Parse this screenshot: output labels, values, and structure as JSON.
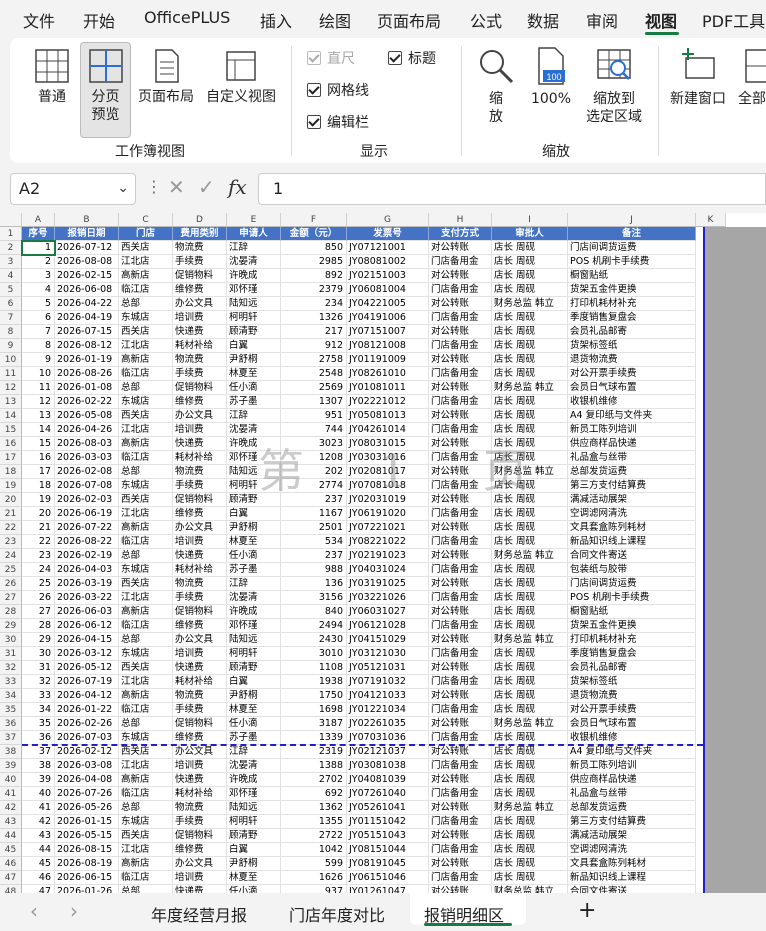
{
  "menu": {
    "items": [
      "文件",
      "开始",
      "OfficePLUS",
      "插入",
      "绘图",
      "页面布局",
      "公式",
      "数据",
      "审阅",
      "视图",
      "PDF工具"
    ],
    "active_index": 9
  },
  "ribbon": {
    "workbook_views": {
      "buttons": [
        "普通",
        "分页\n预览",
        "页面布局",
        "自定义视图"
      ],
      "selected": "分页\n预览",
      "group_label": "工作簿视图"
    },
    "show": {
      "checkboxes": [
        {
          "label": "直尺",
          "checked": true,
          "disabled": true
        },
        {
          "label": "标题",
          "checked": true,
          "disabled": false
        },
        {
          "label": "网格线",
          "checked": true,
          "disabled": false
        },
        {
          "label": "编辑栏",
          "checked": true,
          "disabled": false
        }
      ],
      "group_label": "显示"
    },
    "zoom": {
      "zoom_label": "缩\n放",
      "pct_label": "100%",
      "pct_icon_text": "100",
      "fit_label": "缩放到\n选定区域",
      "group_label": "缩放"
    },
    "window": {
      "new_window_label": "新建窗口",
      "all_label": "全部"
    }
  },
  "formula_bar": {
    "name_box": "A2",
    "chevron": "⌄",
    "cancel": "✕",
    "enter": "✓",
    "fx": "fx",
    "value": "1"
  },
  "sheet": {
    "col_letters": [
      "A",
      "B",
      "C",
      "D",
      "E",
      "F",
      "G",
      "H",
      "I",
      "J",
      "K"
    ],
    "headers": [
      "序号",
      "报销日期",
      "门店",
      "费用类别",
      "申请人",
      "金额（元）",
      "发票号",
      "支付方式",
      "审批人",
      "备注"
    ],
    "watermark": "第 1 页",
    "rows": [
      [
        "1",
        "2026-07-12",
        "西关店",
        "物流费",
        "江辞",
        "850",
        "JY07121001",
        "对公转账",
        "店长 周砚",
        "门店间调货运费"
      ],
      [
        "2",
        "2026-08-08",
        "江北店",
        "手续费",
        "沈晏清",
        "2985",
        "JY08081002",
        "门店备用金",
        "店长 周砚",
        "POS 机刷卡手续费"
      ],
      [
        "3",
        "2026-02-15",
        "高新店",
        "促销物料",
        "许晚成",
        "892",
        "JY02151003",
        "对公转账",
        "店长 周砚",
        "橱窗贴纸"
      ],
      [
        "4",
        "2026-06-08",
        "临江店",
        "维修费",
        "邓怀瑾",
        "2379",
        "JY06081004",
        "门店备用金",
        "店长 周砚",
        "货架五金件更换"
      ],
      [
        "5",
        "2026-04-22",
        "总部",
        "办公文具",
        "陆知远",
        "234",
        "JY04221005",
        "对公转账",
        "财务总监 韩立",
        "打印机耗材补充"
      ],
      [
        "6",
        "2026-04-19",
        "东城店",
        "培训费",
        "柯明轩",
        "1326",
        "JY04191006",
        "门店备用金",
        "店长 周砚",
        "季度销售复盘会"
      ],
      [
        "7",
        "2026-07-15",
        "西关店",
        "快递费",
        "顾清野",
        "217",
        "JY07151007",
        "对公转账",
        "店长 周砚",
        "会员礼品邮寄"
      ],
      [
        "8",
        "2026-08-12",
        "江北店",
        "耗材补给",
        "白翼",
        "912",
        "JY08121008",
        "门店备用金",
        "店长 周砚",
        "货架标签纸"
      ],
      [
        "9",
        "2026-01-19",
        "高新店",
        "物流费",
        "尹舒桐",
        "2758",
        "JY01191009",
        "对公转账",
        "店长 周砚",
        "退货物流费"
      ],
      [
        "10",
        "2026-08-26",
        "临江店",
        "手续费",
        "林夏至",
        "2548",
        "JY08261010",
        "门店备用金",
        "店长 周砚",
        "对公开票手续费"
      ],
      [
        "11",
        "2026-01-08",
        "总部",
        "促销物料",
        "任小滴",
        "2569",
        "JY01081011",
        "对公转账",
        "财务总监 韩立",
        "会员日气球布置"
      ],
      [
        "12",
        "2026-02-22",
        "东城店",
        "维修费",
        "苏子墨",
        "1307",
        "JY02221012",
        "门店备用金",
        "店长 周砚",
        "收银机维修"
      ],
      [
        "13",
        "2026-05-08",
        "西关店",
        "办公文具",
        "江辞",
        "951",
        "JY05081013",
        "对公转账",
        "店长 周砚",
        "A4 复印纸与文件夹"
      ],
      [
        "14",
        "2026-04-26",
        "江北店",
        "培训费",
        "沈晏清",
        "744",
        "JY04261014",
        "门店备用金",
        "店长 周砚",
        "新员工陈列培训"
      ],
      [
        "15",
        "2026-08-03",
        "高新店",
        "快递费",
        "许晚成",
        "3023",
        "JY08031015",
        "对公转账",
        "店长 周砚",
        "供应商样品快递"
      ],
      [
        "16",
        "2026-03-03",
        "临江店",
        "耗材补给",
        "邓怀瑾",
        "1208",
        "JY03031016",
        "门店备用金",
        "店长 周砚",
        "礼品盒与丝带"
      ],
      [
        "17",
        "2026-02-08",
        "总部",
        "物流费",
        "陆知远",
        "202",
        "JY02081017",
        "对公转账",
        "财务总监 韩立",
        "总部发货运费"
      ],
      [
        "18",
        "2026-07-08",
        "东城店",
        "手续费",
        "柯明轩",
        "2774",
        "JY07081018",
        "门店备用金",
        "店长 周砚",
        "第三方支付结算费"
      ],
      [
        "19",
        "2026-02-03",
        "西关店",
        "促销物料",
        "顾清野",
        "237",
        "JY02031019",
        "对公转账",
        "店长 周砚",
        "满减活动展架"
      ],
      [
        "20",
        "2026-06-19",
        "江北店",
        "维修费",
        "白翼",
        "1167",
        "JY06191020",
        "门店备用金",
        "店长 周砚",
        "空调滤网清洗"
      ],
      [
        "21",
        "2026-07-22",
        "高新店",
        "办公文具",
        "尹舒桐",
        "2501",
        "JY07221021",
        "对公转账",
        "店长 周砚",
        "文具套盒陈列耗材"
      ],
      [
        "22",
        "2026-08-22",
        "临江店",
        "培训费",
        "林夏至",
        "534",
        "JY08221022",
        "门店备用金",
        "店长 周砚",
        "新品知识线上课程"
      ],
      [
        "23",
        "2026-02-19",
        "总部",
        "快递费",
        "任小滴",
        "237",
        "JY02191023",
        "对公转账",
        "财务总监 韩立",
        "合同文件寄送"
      ],
      [
        "24",
        "2026-04-03",
        "东城店",
        "耗材补给",
        "苏子墨",
        "988",
        "JY04031024",
        "门店备用金",
        "店长 周砚",
        "包装纸与胶带"
      ],
      [
        "25",
        "2026-03-19",
        "西关店",
        "物流费",
        "江辞",
        "136",
        "JY03191025",
        "对公转账",
        "店长 周砚",
        "门店间调货运费"
      ],
      [
        "26",
        "2026-03-22",
        "江北店",
        "手续费",
        "沈晏清",
        "3156",
        "JY03221026",
        "门店备用金",
        "店长 周砚",
        "POS 机刷卡手续费"
      ],
      [
        "27",
        "2026-06-03",
        "高新店",
        "促销物料",
        "许晚成",
        "840",
        "JY06031027",
        "对公转账",
        "店长 周砚",
        "橱窗贴纸"
      ],
      [
        "28",
        "2026-06-12",
        "临江店",
        "维修费",
        "邓怀瑾",
        "2494",
        "JY06121028",
        "门店备用金",
        "店长 周砚",
        "货架五金件更换"
      ],
      [
        "29",
        "2026-04-15",
        "总部",
        "办公文具",
        "陆知远",
        "2430",
        "JY04151029",
        "对公转账",
        "财务总监 韩立",
        "打印机耗材补充"
      ],
      [
        "30",
        "2026-03-12",
        "东城店",
        "培训费",
        "柯明轩",
        "3010",
        "JY03121030",
        "门店备用金",
        "店长 周砚",
        "季度销售复盘会"
      ],
      [
        "31",
        "2026-05-12",
        "西关店",
        "快递费",
        "顾清野",
        "1108",
        "JY05121031",
        "对公转账",
        "店长 周砚",
        "会员礼品邮寄"
      ],
      [
        "32",
        "2026-07-19",
        "江北店",
        "耗材补给",
        "白翼",
        "1938",
        "JY07191032",
        "门店备用金",
        "店长 周砚",
        "货架标签纸"
      ],
      [
        "33",
        "2026-04-12",
        "高新店",
        "物流费",
        "尹舒桐",
        "1750",
        "JY04121033",
        "对公转账",
        "店长 周砚",
        "退货物流费"
      ],
      [
        "34",
        "2026-01-22",
        "临江店",
        "手续费",
        "林夏至",
        "1698",
        "JY01221034",
        "门店备用金",
        "店长 周砚",
        "对公开票手续费"
      ],
      [
        "35",
        "2026-02-26",
        "总部",
        "促销物料",
        "任小滴",
        "3187",
        "JY02261035",
        "对公转账",
        "财务总监 韩立",
        "会员日气球布置"
      ],
      [
        "36",
        "2026-07-03",
        "东城店",
        "维修费",
        "苏子墨",
        "1339",
        "JY07031036",
        "门店备用金",
        "店长 周砚",
        "收银机维修"
      ],
      [
        "37",
        "2026-02-12",
        "西关店",
        "办公文具",
        "江辞",
        "2319",
        "JY02121037",
        "对公转账",
        "店长 周砚",
        "A4 复印纸与文件夹"
      ],
      [
        "38",
        "2026-03-08",
        "江北店",
        "培训费",
        "沈晏清",
        "1388",
        "JY03081038",
        "门店备用金",
        "店长 周砚",
        "新员工陈列培训"
      ],
      [
        "39",
        "2026-04-08",
        "高新店",
        "快递费",
        "许晚成",
        "2702",
        "JY04081039",
        "对公转账",
        "店长 周砚",
        "供应商样品快递"
      ],
      [
        "40",
        "2026-07-26",
        "临江店",
        "耗材补给",
        "邓怀瑾",
        "692",
        "JY07261040",
        "门店备用金",
        "店长 周砚",
        "礼品盒与丝带"
      ],
      [
        "41",
        "2026-05-26",
        "总部",
        "物流费",
        "陆知远",
        "1362",
        "JY05261041",
        "对公转账",
        "财务总监 韩立",
        "总部发货运费"
      ],
      [
        "42",
        "2026-01-15",
        "东城店",
        "手续费",
        "柯明轩",
        "1355",
        "JY01151042",
        "门店备用金",
        "店长 周砚",
        "第三方支付结算费"
      ],
      [
        "43",
        "2026-05-15",
        "西关店",
        "促销物料",
        "顾清野",
        "2722",
        "JY05151043",
        "对公转账",
        "店长 周砚",
        "满减活动展架"
      ],
      [
        "44",
        "2026-08-15",
        "江北店",
        "维修费",
        "白翼",
        "1042",
        "JY08151044",
        "门店备用金",
        "店长 周砚",
        "空调滤网清洗"
      ],
      [
        "45",
        "2026-08-19",
        "高新店",
        "办公文具",
        "尹舒桐",
        "599",
        "JY08191045",
        "对公转账",
        "店长 周砚",
        "文具套盒陈列耗材"
      ],
      [
        "46",
        "2026-06-15",
        "临江店",
        "培训费",
        "林夏至",
        "1626",
        "JY06151046",
        "门店备用金",
        "店长 周砚",
        "新品知识线上课程"
      ],
      [
        "47",
        "2026-01-26",
        "总部",
        "快递费",
        "任小滴",
        "937",
        "JY01261047",
        "对公转账",
        "财务总监 韩立",
        "合同文件寄送"
      ]
    ]
  },
  "tabs": {
    "prev": "‹",
    "next": "›",
    "items": [
      "年度经营月报",
      "门店年度对比",
      "报销明细区"
    ],
    "active_index": 2,
    "add": "+"
  },
  "colors": {
    "header_blue": "#4472c4",
    "page_break_blue": "#2020c8",
    "accent_green": "#1a7a44"
  }
}
